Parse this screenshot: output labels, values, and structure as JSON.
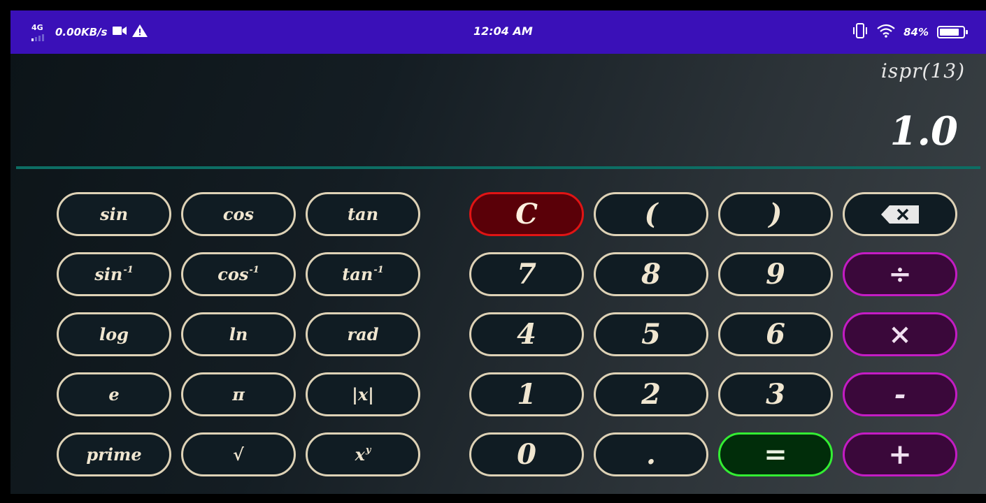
{
  "status_bar": {
    "network": "4G",
    "speed": "0.00KB/s",
    "time": "12:04 AM",
    "battery": "84%",
    "battery_level": 0.84,
    "icons": [
      "video-camera-icon",
      "warning-icon",
      "vibrate-icon",
      "wifi-icon",
      "battery-icon"
    ]
  },
  "display": {
    "expression": "ispr(13)",
    "result": "1.0"
  },
  "scientific_keys": {
    "sin": "sin",
    "cos": "cos",
    "tan": "tan",
    "asin": "sin",
    "acos": "cos",
    "atan": "tan",
    "inverse_sup": "-1",
    "log": "log",
    "ln": "ln",
    "rad": "rad",
    "e": "e",
    "pi": "π",
    "abs": "|x|",
    "prime": "prime",
    "sqrt": "√",
    "pow_base": "x",
    "pow_exp": "y"
  },
  "keypad": {
    "clear": "C",
    "open_paren": "(",
    "close_paren": ")",
    "backspace_icon": "backspace-icon",
    "seven": "7",
    "eight": "8",
    "nine": "9",
    "divide": "÷",
    "four": "4",
    "five": "5",
    "six": "6",
    "multiply": "×",
    "one": "1",
    "two": "2",
    "three": "3",
    "minus": "-",
    "zero": "0",
    "dot": ".",
    "equals": "=",
    "plus": "+"
  },
  "colors": {
    "status_bar": "#3a10b8",
    "divider": "#0d6e64",
    "button_border": "#ded2b6",
    "clear_button": "#e01414",
    "equals_button": "#33ee33",
    "operator_button": "#c41cc4"
  }
}
